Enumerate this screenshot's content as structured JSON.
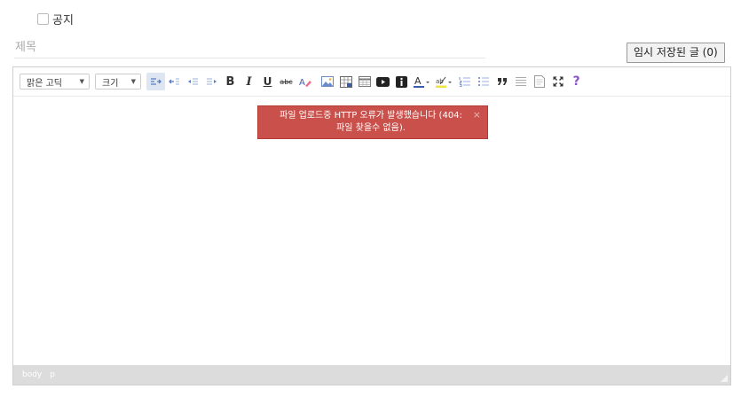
{
  "notice": {
    "label": "공지",
    "checked": false
  },
  "title_field": {
    "placeholder": "제목",
    "value": ""
  },
  "draft_button": {
    "label": "임시 저장된 글 (0)"
  },
  "toolbar": {
    "font_dropdown": "맑은 고딕",
    "size_dropdown": "크기",
    "bold": "B",
    "italic": "I",
    "underline": "U",
    "strike": "abc",
    "help": "?"
  },
  "error": {
    "message": "파일 업로드중 HTTP 오류가 발생했습니다 (404: 파일 찾을수 없음).",
    "close": "×"
  },
  "statusbar": {
    "path": [
      "body",
      "p"
    ]
  },
  "colors": {
    "accent": "#3a5ba8",
    "error_bg": "#c9504b",
    "statusbar_bg": "#dcdcdc"
  }
}
